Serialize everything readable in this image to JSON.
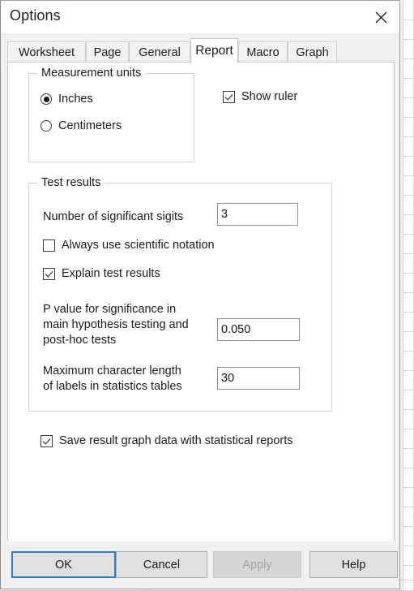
{
  "window": {
    "title": "Options",
    "close_icon": "close-icon"
  },
  "tabs": [
    {
      "label": "Worksheet",
      "active": false
    },
    {
      "label": "Page",
      "active": false
    },
    {
      "label": "General",
      "active": false
    },
    {
      "label": "Report",
      "active": true
    },
    {
      "label": "Macro",
      "active": false
    },
    {
      "label": "Graph",
      "active": false
    }
  ],
  "measurement_units": {
    "legend": "Measurement units",
    "options": [
      {
        "label": "Inches",
        "selected": true
      },
      {
        "label": "Centimeters",
        "selected": false
      }
    ]
  },
  "show_ruler": {
    "label": "Show ruler",
    "checked": true
  },
  "test_results": {
    "legend": "Test results",
    "significant_digits": {
      "label": "Number of significant sigits",
      "value": "3"
    },
    "scientific_notation": {
      "label": "Always use scientific notation",
      "checked": false
    },
    "explain_results": {
      "label": "Explain test results",
      "checked": true
    },
    "p_value": {
      "label": "P value for significance in\nmain hypothesis testing and\npost-hoc tests",
      "value": "0.050"
    },
    "max_label_length": {
      "label": "Maximum character length\nof labels in statistics tables",
      "value": "30"
    }
  },
  "save_graph_data": {
    "label": "Save result graph data with statistical reports",
    "checked": true
  },
  "footer": {
    "ok": "OK",
    "cancel": "Cancel",
    "apply": "Apply",
    "help": "Help",
    "apply_disabled": true
  },
  "colors": {
    "accent": "#2f7fbf",
    "dialog_bg": "#f0f0f0",
    "panel_bg": "#ffffff",
    "text": "#1b1b1b",
    "disabled_text": "#a3a3a3"
  }
}
